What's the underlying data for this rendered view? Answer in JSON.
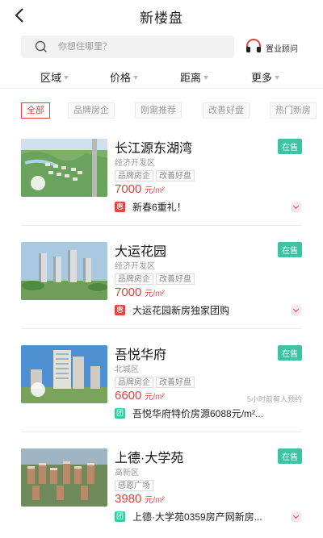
{
  "header": {
    "title": "新楼盘"
  },
  "search": {
    "placeholder": "你想住哪里？"
  },
  "advisor": {
    "label": "置业顾问"
  },
  "filters": [
    {
      "label": "区域"
    },
    {
      "label": "价格"
    },
    {
      "label": "距离"
    },
    {
      "label": "更多"
    }
  ],
  "tags": [
    {
      "label": "全部",
      "active": true
    },
    {
      "label": "品牌房企"
    },
    {
      "label": "刚需推荐"
    },
    {
      "label": "改善好盘"
    },
    {
      "label": "热门新房"
    }
  ],
  "colors": {
    "accent": "#e64340",
    "status": "#3cc4a3"
  },
  "listings": [
    {
      "name": "长江源东湖湾",
      "status": "在售",
      "district": "经济开发区",
      "labels": [
        "品牌房企",
        "改善好盘"
      ],
      "price": "7000",
      "unit": "元/m²",
      "recent": "",
      "promo_badge": "惠",
      "promo_text": "新春6重礼！"
    },
    {
      "name": "大运花园",
      "status": "在售",
      "district": "经济开发区",
      "labels": [
        "品牌房企",
        "改善好盘"
      ],
      "price": "7000",
      "unit": "元/m²",
      "recent": "",
      "promo_badge": "惠",
      "promo_text": "大运花园新房独家团购"
    },
    {
      "name": "吾悦华府",
      "status": "在售",
      "district": "北城区",
      "labels": [
        "品牌房企",
        "改善好盘"
      ],
      "price": "6600",
      "unit": "元/m²",
      "recent": "5小时前有人预约",
      "promo_badge": "团",
      "promo_text": "吾悦华府特价房源6088元/m²..."
    },
    {
      "name": "上德·大学苑",
      "status": "在售",
      "district": "高新区",
      "labels": [
        "感恩广场"
      ],
      "price": "3980",
      "unit": "元/m²",
      "recent": "",
      "promo_badge": "团",
      "promo_text": "上德·大学苑0359房产网新房..."
    }
  ]
}
